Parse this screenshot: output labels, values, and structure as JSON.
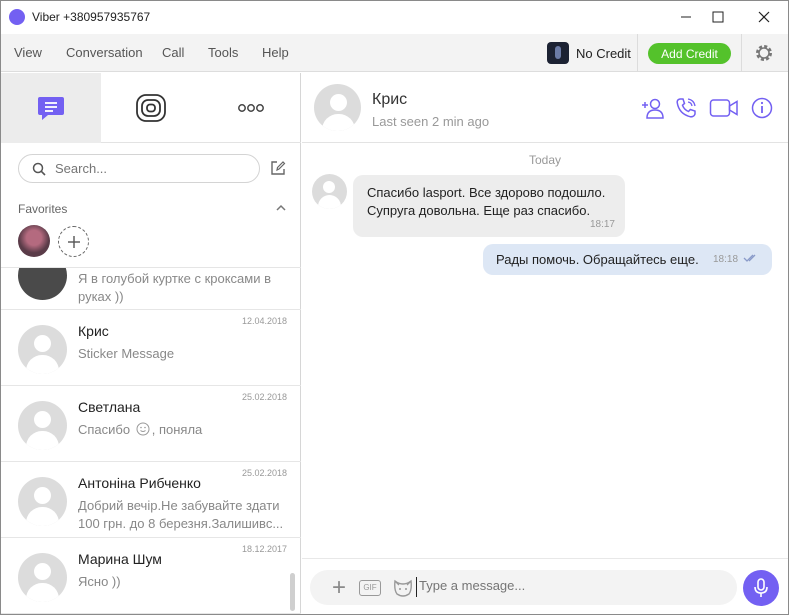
{
  "window": {
    "title": "Viber +380957935767"
  },
  "menu": {
    "items": [
      "View",
      "Conversation",
      "Call",
      "Tools",
      "Help"
    ],
    "credit_status": "No Credit",
    "add_credit": "Add Credit"
  },
  "sidebar": {
    "search_placeholder": "Search...",
    "favorites_label": "Favorites",
    "chats": [
      {
        "name": "",
        "preview": "Я в голубой куртке с кроксами в руках ))",
        "date": ""
      },
      {
        "name": "Крис",
        "preview": "Sticker Message",
        "date": "12.04.2018"
      },
      {
        "name": "Светлана",
        "preview": "Спасибо",
        "preview_after": ", поняла",
        "date": "25.02.2018"
      },
      {
        "name": "Антоніна Рибченко",
        "preview": "Добрий вечір.Не забувайте здати 100 грн. до 8 березня.Залишивс...",
        "date": "25.02.2018"
      },
      {
        "name": "Марина Шум",
        "preview": "Ясно ))",
        "date": "18.12.2017"
      }
    ]
  },
  "conversation": {
    "contact_name": "Крис",
    "last_seen": "Last seen 2 min ago",
    "day_label": "Today",
    "messages": [
      {
        "direction": "in",
        "text_line1": "Спасибо lasport. Все здорово подошло.",
        "text_line2": "Супруга довольна. Еще раз спасибо.",
        "time": "18:17"
      },
      {
        "direction": "out",
        "text": "Рады помочь. Обращайтесь еще.",
        "time": "18:18"
      }
    ],
    "composer_placeholder": "Type a message...",
    "gif_label": "GIF"
  },
  "colors": {
    "viber_purple": "#7360f2",
    "add_credit_green": "#54c22b",
    "outgoing_bubble": "#dde7f5",
    "incoming_bubble": "#ededed"
  }
}
